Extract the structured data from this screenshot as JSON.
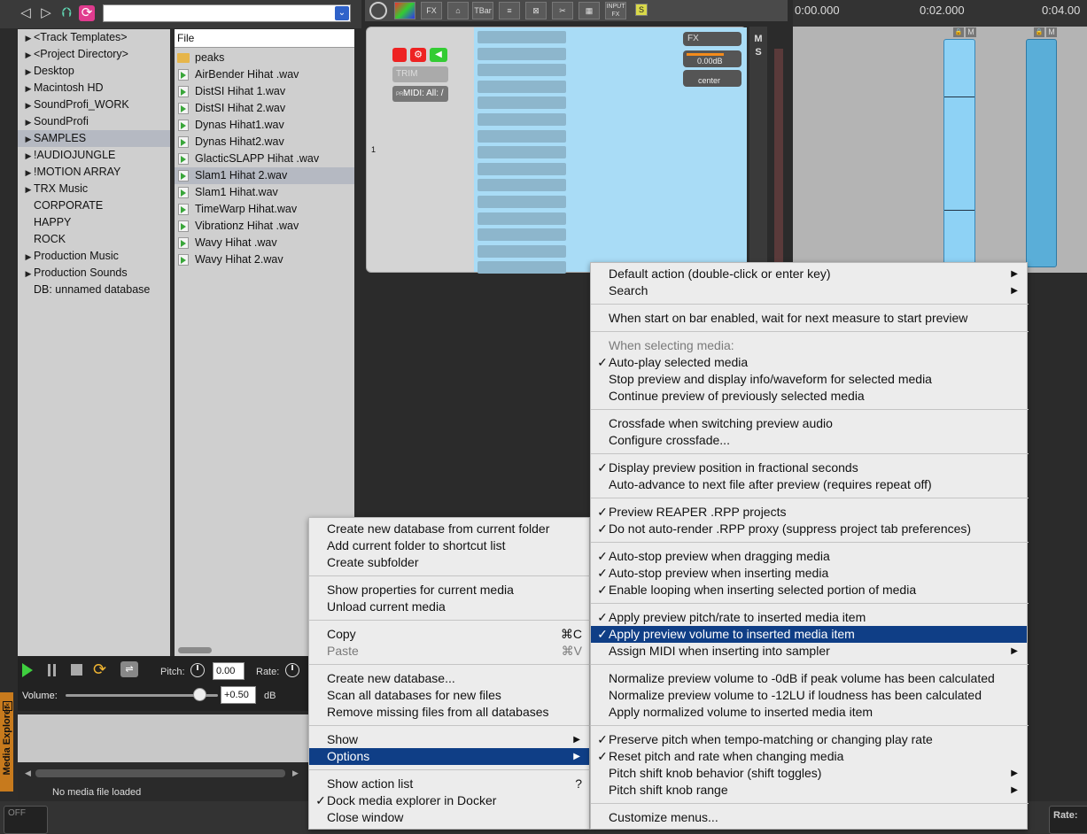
{
  "toolbar": {
    "path_value": ""
  },
  "tree": {
    "items": [
      {
        "label": "<Track Templates>",
        "expand": true
      },
      {
        "label": "<Project Directory>",
        "expand": true
      },
      {
        "label": "Desktop",
        "expand": true
      },
      {
        "label": "Macintosh HD",
        "expand": true
      },
      {
        "label": "SoundProfi_WORK",
        "expand": true
      },
      {
        "label": "SoundProfi",
        "expand": true
      },
      {
        "label": "SAMPLES",
        "expand": true,
        "selected": true
      },
      {
        "label": "!AUDIOJUNGLE",
        "expand": true
      },
      {
        "label": "!MOTION ARRAY",
        "expand": true
      },
      {
        "label": "TRX Music",
        "expand": true
      },
      {
        "label": "CORPORATE",
        "expand": false
      },
      {
        "label": "HAPPY",
        "expand": false
      },
      {
        "label": "ROCK",
        "expand": false
      },
      {
        "label": "Production Music",
        "expand": true
      },
      {
        "label": "Production Sounds",
        "expand": true
      },
      {
        "label": "DB: unnamed database",
        "expand": false
      }
    ]
  },
  "files": {
    "header": "File",
    "items": [
      {
        "label": "peaks",
        "folder": true
      },
      {
        "label": "AirBender Hihat .wav"
      },
      {
        "label": "DistSI Hihat 1.wav"
      },
      {
        "label": "DistSI Hihat 2.wav"
      },
      {
        "label": "Dynas Hihat1.wav"
      },
      {
        "label": "Dynas Hihat2.wav"
      },
      {
        "label": "GlacticSLAPP Hihat .wav"
      },
      {
        "label": "Slam1 Hihat 2.wav",
        "selected": true
      },
      {
        "label": "Slam1 Hihat.wav"
      },
      {
        "label": "TimeWarp Hihat.wav"
      },
      {
        "label": "Vibrationz Hihat .wav"
      },
      {
        "label": "Wavy Hihat .wav"
      },
      {
        "label": "Wavy Hihat 2.wav"
      }
    ]
  },
  "transport": {
    "pitch_label": "Pitch:",
    "pitch_value": "0.00",
    "rate_label": "Rate:",
    "volume_label": "Volume:",
    "volume_value": "+0.50",
    "volume_unit": "dB",
    "volume_level": 0.88
  },
  "status": {
    "text": "No media file loaded",
    "side_tab": "Media Explorer"
  },
  "mixer": {
    "toolbar_labels": {
      "fx": "FX",
      "tbar": "TBar",
      "input_fx": "INPUT FX",
      "s": "S"
    },
    "trim": "TRIM",
    "midi": "MIDI: All: /",
    "pre": "PRE",
    "track_number": "1",
    "fx_label": "FX",
    "volume": "0.00dB",
    "pan": "center",
    "m": "M",
    "s": "S"
  },
  "ruler": {
    "marks": [
      "0:00.000",
      "0:02.000",
      "0:04.00"
    ],
    "clip_m": "M"
  },
  "bottom": {
    "off": "OFF",
    "rate": "Rate:"
  },
  "context_menu": {
    "items": [
      {
        "label": "Create new database from current folder"
      },
      {
        "label": "Add current folder to shortcut list"
      },
      {
        "label": "Create subfolder"
      },
      {
        "sep": true
      },
      {
        "label": "Show properties for current media"
      },
      {
        "label": "Unload current media"
      },
      {
        "sep": true
      },
      {
        "label": "Copy",
        "shortcut": "⌘C"
      },
      {
        "label": "Paste",
        "shortcut": "⌘V",
        "disabled": true
      },
      {
        "sep": true
      },
      {
        "label": "Create new database..."
      },
      {
        "label": "Scan all databases for new files"
      },
      {
        "label": "Remove missing files from all databases"
      },
      {
        "sep": true
      },
      {
        "label": "Show",
        "submenu": true
      },
      {
        "label": "Options",
        "submenu": true,
        "highlighted": true
      },
      {
        "sep": true
      },
      {
        "label": "Show action list",
        "shortcut": "?"
      },
      {
        "label": "Dock media explorer in Docker",
        "checked": true
      },
      {
        "label": "Close window"
      }
    ]
  },
  "options_menu": {
    "items": [
      {
        "label": "Default action (double-click or enter key)",
        "submenu": true
      },
      {
        "label": "Search",
        "submenu": true
      },
      {
        "sep": true
      },
      {
        "label": "When start on bar enabled, wait for next measure to start preview"
      },
      {
        "sep": true
      },
      {
        "label": "When selecting media:",
        "disabled": true
      },
      {
        "label": "Auto-play selected media",
        "checked": true
      },
      {
        "label": "Stop preview and display info/waveform for selected media"
      },
      {
        "label": "Continue preview of previously selected media"
      },
      {
        "sep": true
      },
      {
        "label": "Crossfade when switching preview audio"
      },
      {
        "label": "Configure crossfade..."
      },
      {
        "sep": true
      },
      {
        "label": "Display preview position in fractional seconds",
        "checked": true
      },
      {
        "label": "Auto-advance to next file after preview (requires repeat off)"
      },
      {
        "sep": true
      },
      {
        "label": "Preview REAPER .RPP projects",
        "checked": true
      },
      {
        "label": "Do not auto-render .RPP proxy (suppress project tab preferences)",
        "checked": true
      },
      {
        "sep": true
      },
      {
        "label": "Auto-stop preview when dragging media",
        "checked": true
      },
      {
        "label": "Auto-stop preview when inserting media",
        "checked": true
      },
      {
        "label": "Enable looping when inserting selected portion of media",
        "checked": true
      },
      {
        "sep": true
      },
      {
        "label": "Apply preview pitch/rate to inserted media item",
        "checked": true
      },
      {
        "label": "Apply preview volume to inserted media item",
        "checked": true,
        "highlighted": true
      },
      {
        "label": "Assign MIDI when inserting into sampler",
        "submenu": true
      },
      {
        "sep": true
      },
      {
        "label": "Normalize preview volume to -0dB if peak volume has been calculated"
      },
      {
        "label": "Normalize preview volume to -12LU if loudness has been calculated"
      },
      {
        "label": "Apply normalized volume to inserted media item"
      },
      {
        "sep": true
      },
      {
        "label": "Preserve pitch when tempo-matching or changing play rate",
        "checked": true
      },
      {
        "label": "Reset pitch and rate when changing media",
        "checked": true
      },
      {
        "label": "Pitch shift knob behavior (shift toggles)",
        "submenu": true
      },
      {
        "label": "Pitch shift knob range",
        "submenu": true
      },
      {
        "sep": true
      },
      {
        "label": "Customize menus..."
      }
    ]
  }
}
